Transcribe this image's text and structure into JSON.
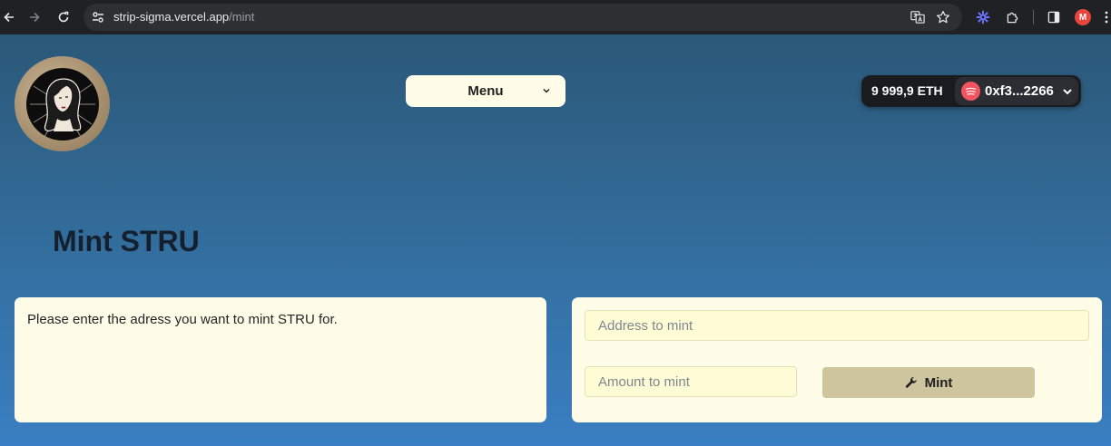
{
  "browser": {
    "url_host": "strip-sigma.vercel.app",
    "url_path": "/mint",
    "profile_initial": "M",
    "icons": [
      "back-arrow-icon",
      "forward-arrow-icon",
      "reload-icon",
      "site-settings-icon",
      "translate-icon",
      "bookmark-star-icon",
      "extension-gear-icon",
      "extensions-puzzle-icon",
      "side-panel-icon",
      "more-menu-icon"
    ]
  },
  "header": {
    "menu_label": "Menu",
    "wallet": {
      "balance": "9 999,9 ETH",
      "address": "0xf3...2266"
    }
  },
  "main": {
    "title": "Mint STRU",
    "info_text": "Please enter the adress you want to mint STRU for.",
    "form": {
      "address_placeholder": "Address to mint",
      "amount_placeholder": "Amount to mint",
      "mint_label": "Mint"
    }
  },
  "colors": {
    "card_bg": "#fffde8",
    "input_bg": "#fefcd5",
    "mint_button": "#cec49e",
    "wallet_bg": "#1a1b1f",
    "avatar": "#f2555f"
  }
}
